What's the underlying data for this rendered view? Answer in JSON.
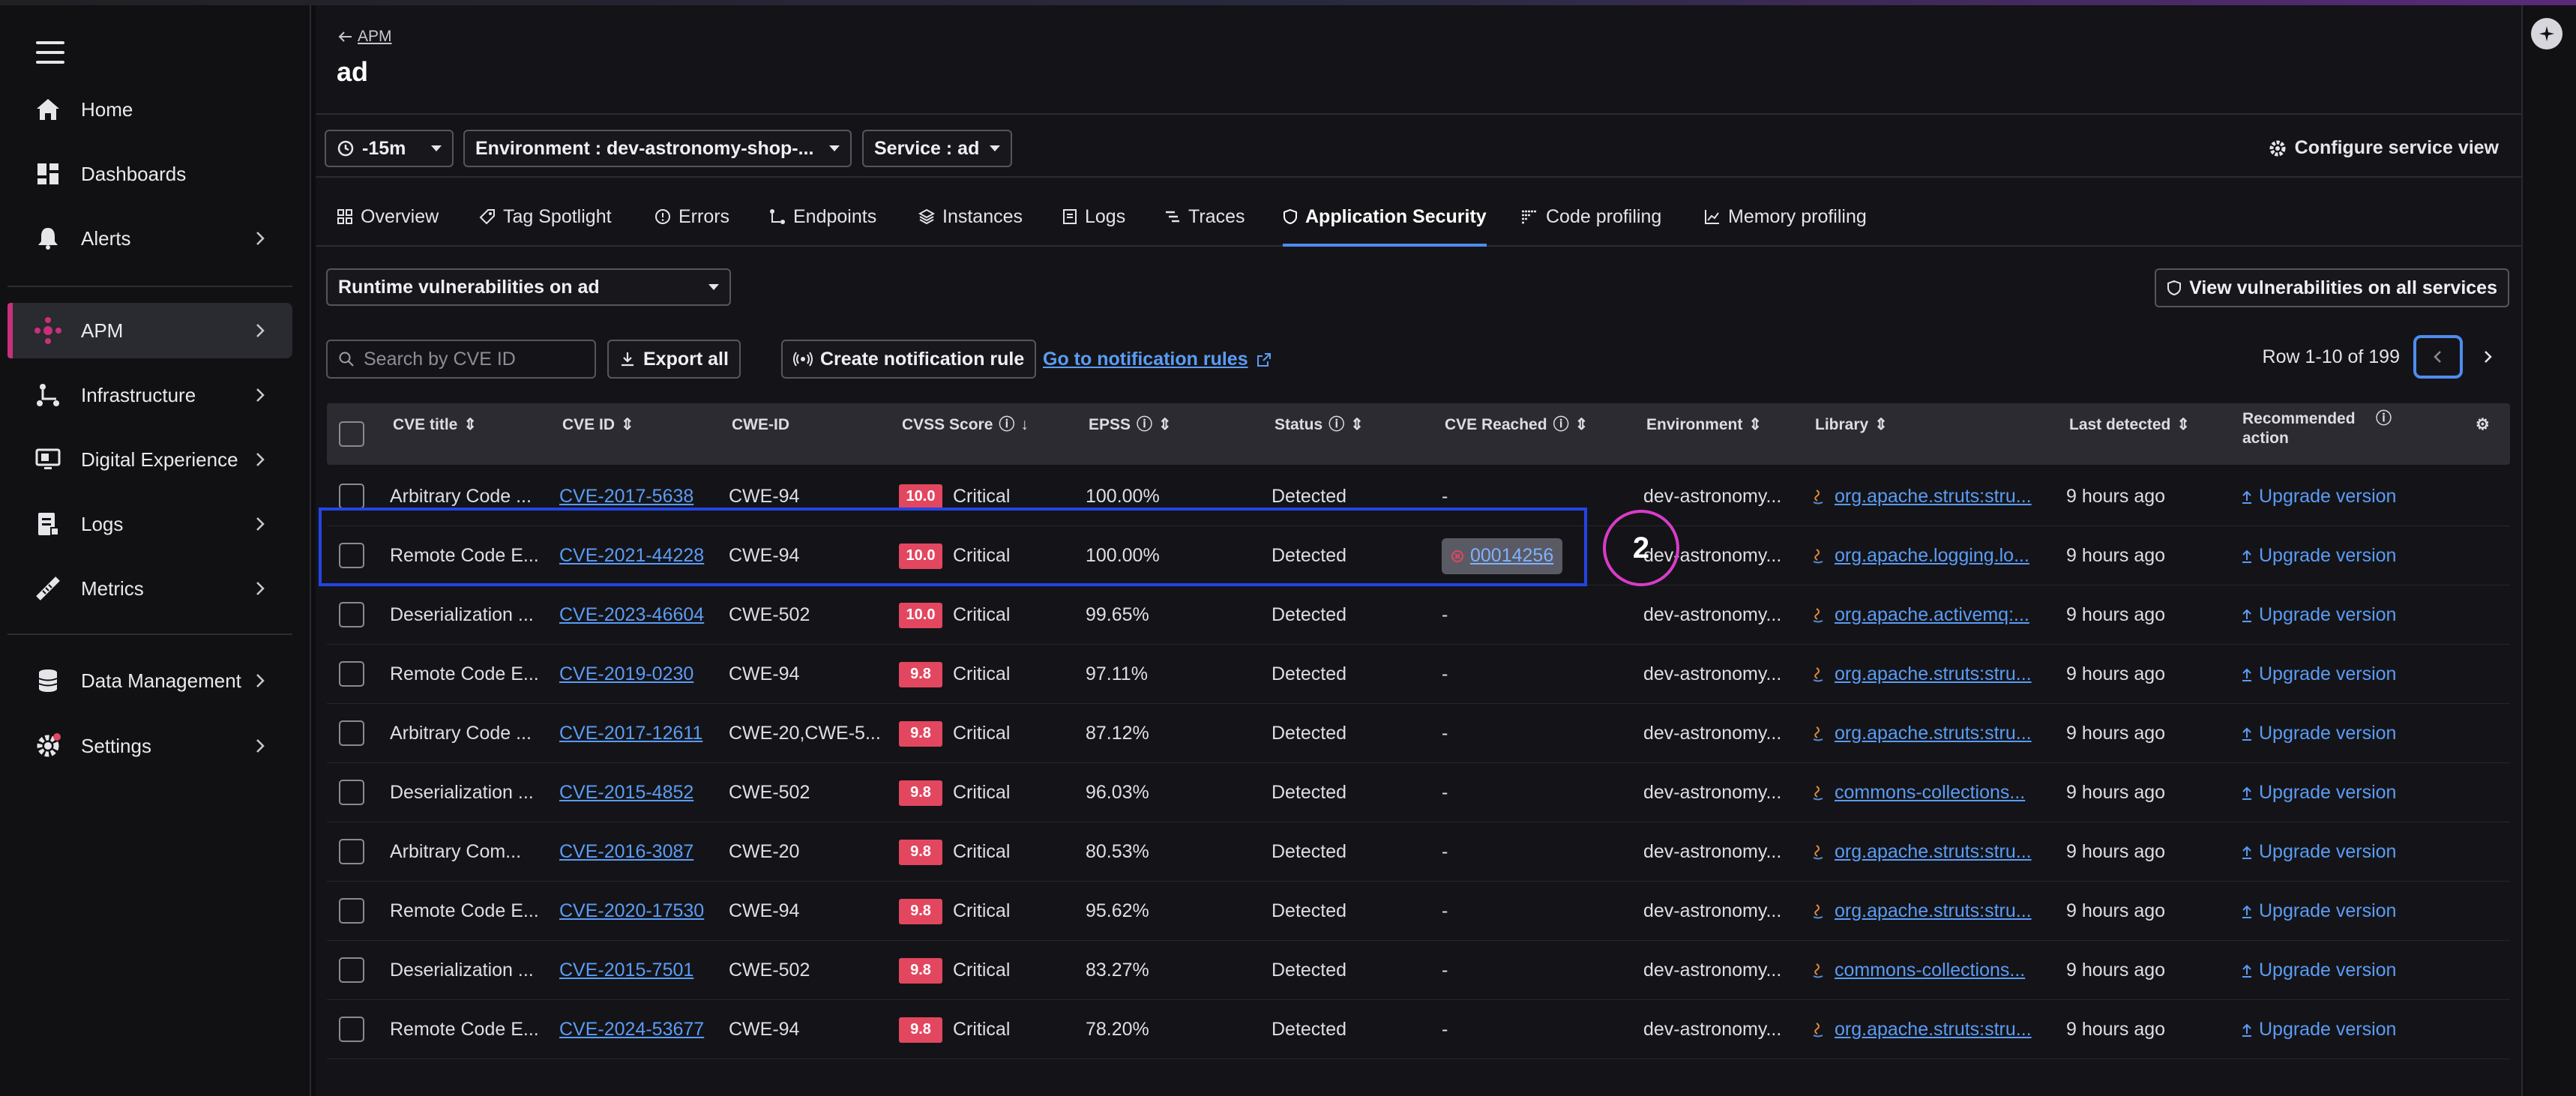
{
  "sidebar": {
    "items": [
      {
        "label": "Home",
        "icon": "home-icon"
      },
      {
        "label": "Dashboards",
        "icon": "dashboards-icon"
      },
      {
        "label": "Alerts",
        "icon": "bell-icon"
      },
      {
        "label": "APM",
        "icon": "apm-icon"
      },
      {
        "label": "Infrastructure",
        "icon": "infrastructure-icon"
      },
      {
        "label": "Digital Experience",
        "icon": "digital-experience-icon"
      },
      {
        "label": "Logs",
        "icon": "logs-icon"
      },
      {
        "label": "Metrics",
        "icon": "metrics-icon"
      },
      {
        "label": "Data Management",
        "icon": "database-icon"
      },
      {
        "label": "Settings",
        "icon": "gear-icon"
      }
    ]
  },
  "header": {
    "back_label": "APM",
    "service_title": "ad"
  },
  "filters": {
    "time": "-15m",
    "environment": "Environment : dev-astronomy-shop-...",
    "service": "Service : ad",
    "configure": "Configure service view"
  },
  "tabs": [
    {
      "label": "Overview"
    },
    {
      "label": "Tag Spotlight"
    },
    {
      "label": "Errors"
    },
    {
      "label": "Endpoints"
    },
    {
      "label": "Instances"
    },
    {
      "label": "Logs"
    },
    {
      "label": "Traces"
    },
    {
      "label": "Application Security"
    },
    {
      "label": "Code profiling"
    },
    {
      "label": "Memory profiling"
    }
  ],
  "controls": {
    "view_select": "Runtime vulnerabilities on ad",
    "view_all": "View vulnerabilities on all services",
    "search_placeholder": "Search by CVE ID",
    "export": "Export all",
    "create_rule": "Create notification rule",
    "goto_rules": "Go to notification rules",
    "pager_text": "Row 1-10 of 199"
  },
  "table": {
    "columns": [
      "CVE title",
      "CVE ID",
      "CWE-ID",
      "CVSS Score",
      "EPSS",
      "Status",
      "CVE Reached",
      "Environment",
      "Library",
      "Last detected",
      "Recommended action"
    ],
    "rows": [
      {
        "title": "Arbitrary Code ...",
        "cve": "CVE-2017-5638",
        "cwe": "CWE-94",
        "cvss": "10.0",
        "severity": "Critical",
        "epss": "100.00%",
        "status": "Detected",
        "reached": "-",
        "env": "dev-astronomy...",
        "lib": "org.apache.struts:stru...",
        "last": "9 hours ago",
        "action": "Upgrade version"
      },
      {
        "title": "Remote Code E...",
        "cve": "CVE-2021-44228",
        "cwe": "CWE-94",
        "cvss": "10.0",
        "severity": "Critical",
        "epss": "100.00%",
        "status": "Detected",
        "reached": "00014256",
        "env": "dev-astronomy...",
        "lib": "org.apache.logging.lo...",
        "last": "9 hours ago",
        "action": "Upgrade version"
      },
      {
        "title": "Deserialization ...",
        "cve": "CVE-2023-46604",
        "cwe": "CWE-502",
        "cvss": "10.0",
        "severity": "Critical",
        "epss": "99.65%",
        "status": "Detected",
        "reached": "-",
        "env": "dev-astronomy...",
        "lib": "org.apache.activemq:...",
        "last": "9 hours ago",
        "action": "Upgrade version"
      },
      {
        "title": "Remote Code E...",
        "cve": "CVE-2019-0230",
        "cwe": "CWE-94",
        "cvss": "9.8",
        "severity": "Critical",
        "epss": "97.11%",
        "status": "Detected",
        "reached": "-",
        "env": "dev-astronomy...",
        "lib": "org.apache.struts:stru...",
        "last": "9 hours ago",
        "action": "Upgrade version"
      },
      {
        "title": "Arbitrary Code ...",
        "cve": "CVE-2017-12611",
        "cwe": "CWE-20,CWE-5...",
        "cvss": "9.8",
        "severity": "Critical",
        "epss": "87.12%",
        "status": "Detected",
        "reached": "-",
        "env": "dev-astronomy...",
        "lib": "org.apache.struts:stru...",
        "last": "9 hours ago",
        "action": "Upgrade version"
      },
      {
        "title": "Deserialization ...",
        "cve": "CVE-2015-4852",
        "cwe": "CWE-502",
        "cvss": "9.8",
        "severity": "Critical",
        "epss": "96.03%",
        "status": "Detected",
        "reached": "-",
        "env": "dev-astronomy...",
        "lib": "commons-collections...",
        "last": "9 hours ago",
        "action": "Upgrade version"
      },
      {
        "title": "Arbitrary Com...",
        "cve": "CVE-2016-3087",
        "cwe": "CWE-20",
        "cvss": "9.8",
        "severity": "Critical",
        "epss": "80.53%",
        "status": "Detected",
        "reached": "-",
        "env": "dev-astronomy...",
        "lib": "org.apache.struts:stru...",
        "last": "9 hours ago",
        "action": "Upgrade version"
      },
      {
        "title": "Remote Code E...",
        "cve": "CVE-2020-17530",
        "cwe": "CWE-94",
        "cvss": "9.8",
        "severity": "Critical",
        "epss": "95.62%",
        "status": "Detected",
        "reached": "-",
        "env": "dev-astronomy...",
        "lib": "org.apache.struts:stru...",
        "last": "9 hours ago",
        "action": "Upgrade version"
      },
      {
        "title": "Deserialization ...",
        "cve": "CVE-2015-7501",
        "cwe": "CWE-502",
        "cvss": "9.8",
        "severity": "Critical",
        "epss": "83.27%",
        "status": "Detected",
        "reached": "-",
        "env": "dev-astronomy...",
        "lib": "commons-collections...",
        "last": "9 hours ago",
        "action": "Upgrade version"
      },
      {
        "title": "Remote Code E...",
        "cve": "CVE-2024-53677",
        "cwe": "CWE-94",
        "cvss": "9.8",
        "severity": "Critical",
        "epss": "78.20%",
        "status": "Detected",
        "reached": "-",
        "env": "dev-astronomy...",
        "lib": "org.apache.struts:stru...",
        "last": "9 hours ago",
        "action": "Upgrade version"
      }
    ]
  },
  "annotation": {
    "step": "2"
  },
  "colors": {
    "accent": "#4f8cf0",
    "critical": "#e2475f",
    "apm_marker": "#c7317a",
    "highlight": "#2444e6",
    "step_ring": "#d93cc8"
  }
}
